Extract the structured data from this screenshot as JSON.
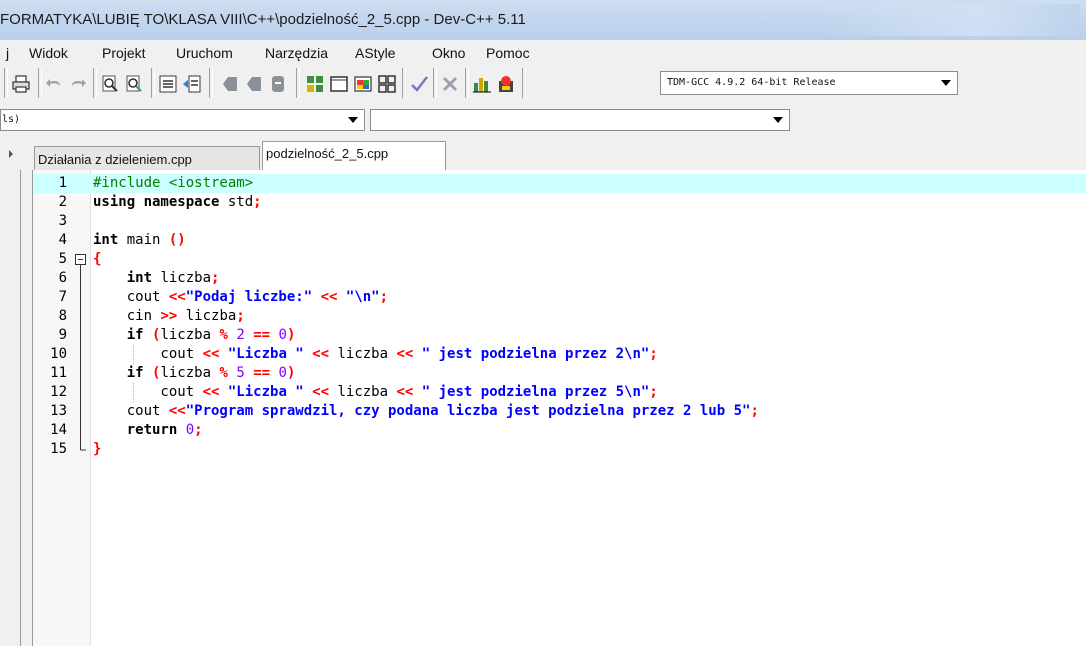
{
  "window": {
    "title": "FORMATYKA\\LUBIĘ TO\\KLASA VIII\\C++\\podzielność_2_5.cpp - Dev-C++ 5.11"
  },
  "menu": {
    "items": [
      "j",
      "Widok",
      "Projekt",
      "Uruchom",
      "Narzędzia",
      "AStyle",
      "Okno",
      "Pomoc"
    ]
  },
  "toolbar": {
    "compiler": "TDM-GCC 4.9.2 64-bit Release",
    "icons": [
      "save-all-icon",
      "print-icon",
      "undo-icon",
      "redo-icon",
      "find-icon",
      "replace-icon",
      "indent-icon",
      "unindent-icon",
      "bookmark-icon",
      "goto-icon",
      "compile-icon",
      "run-icon",
      "compile-run-icon",
      "rebuild-icon",
      "check-icon",
      "stop-icon",
      "chart-icon",
      "profile-icon"
    ]
  },
  "class_browser": {
    "class_combo": "ls)",
    "member_combo": ""
  },
  "tabs": [
    {
      "label": "Działania z dzieleniem.cpp",
      "active": false
    },
    {
      "label": "podzielność_2_5.cpp",
      "active": true
    }
  ],
  "editor": {
    "active_line": 1,
    "lines": [
      {
        "n": "1",
        "tokens": [
          {
            "t": "pp",
            "v": "#include <iostream>"
          }
        ]
      },
      {
        "n": "2",
        "tokens": [
          {
            "t": "kw",
            "v": "using namespace"
          },
          {
            "t": "plain",
            "v": " std"
          },
          {
            "t": "sym",
            "v": ";"
          }
        ]
      },
      {
        "n": "3",
        "tokens": []
      },
      {
        "n": "4",
        "tokens": [
          {
            "t": "kw",
            "v": "int"
          },
          {
            "t": "plain",
            "v": " main "
          },
          {
            "t": "sym",
            "v": "()"
          }
        ]
      },
      {
        "n": "5",
        "tokens": [
          {
            "t": "sym",
            "v": "{"
          }
        ],
        "fold": "start"
      },
      {
        "n": "6",
        "tokens": [
          {
            "t": "plain",
            "v": "    "
          },
          {
            "t": "kw",
            "v": "int"
          },
          {
            "t": "plain",
            "v": " liczba"
          },
          {
            "t": "sym",
            "v": ";"
          }
        ]
      },
      {
        "n": "7",
        "tokens": [
          {
            "t": "plain",
            "v": "    cout "
          },
          {
            "t": "sym",
            "v": "<<"
          },
          {
            "t": "str",
            "v": "\"Podaj liczbe:\""
          },
          {
            "t": "plain",
            "v": " "
          },
          {
            "t": "sym",
            "v": "<<"
          },
          {
            "t": "plain",
            "v": " "
          },
          {
            "t": "str",
            "v": "\"\\n\""
          },
          {
            "t": "sym",
            "v": ";"
          }
        ]
      },
      {
        "n": "8",
        "tokens": [
          {
            "t": "plain",
            "v": "    cin "
          },
          {
            "t": "sym",
            "v": ">>"
          },
          {
            "t": "plain",
            "v": " liczba"
          },
          {
            "t": "sym",
            "v": ";"
          }
        ]
      },
      {
        "n": "9",
        "tokens": [
          {
            "t": "plain",
            "v": "    "
          },
          {
            "t": "kw",
            "v": "if"
          },
          {
            "t": "plain",
            "v": " "
          },
          {
            "t": "sym",
            "v": "("
          },
          {
            "t": "plain",
            "v": "liczba "
          },
          {
            "t": "sym",
            "v": "%"
          },
          {
            "t": "plain",
            "v": " "
          },
          {
            "t": "num",
            "v": "2"
          },
          {
            "t": "plain",
            "v": " "
          },
          {
            "t": "sym",
            "v": "=="
          },
          {
            "t": "plain",
            "v": " "
          },
          {
            "t": "num",
            "v": "0"
          },
          {
            "t": "sym",
            "v": ")"
          }
        ]
      },
      {
        "n": "10",
        "tokens": [
          {
            "t": "plain",
            "v": "        cout "
          },
          {
            "t": "sym",
            "v": "<<"
          },
          {
            "t": "plain",
            "v": " "
          },
          {
            "t": "str",
            "v": "\"Liczba \""
          },
          {
            "t": "plain",
            "v": " "
          },
          {
            "t": "sym",
            "v": "<<"
          },
          {
            "t": "plain",
            "v": " liczba "
          },
          {
            "t": "sym",
            "v": "<<"
          },
          {
            "t": "plain",
            "v": " "
          },
          {
            "t": "str",
            "v": "\" jest podzielna przez 2\\n\""
          },
          {
            "t": "sym",
            "v": ";"
          }
        ],
        "guide": true
      },
      {
        "n": "11",
        "tokens": [
          {
            "t": "plain",
            "v": "    "
          },
          {
            "t": "kw",
            "v": "if"
          },
          {
            "t": "plain",
            "v": " "
          },
          {
            "t": "sym",
            "v": "("
          },
          {
            "t": "plain",
            "v": "liczba "
          },
          {
            "t": "sym",
            "v": "%"
          },
          {
            "t": "plain",
            "v": " "
          },
          {
            "t": "num",
            "v": "5"
          },
          {
            "t": "plain",
            "v": " "
          },
          {
            "t": "sym",
            "v": "=="
          },
          {
            "t": "plain",
            "v": " "
          },
          {
            "t": "num",
            "v": "0"
          },
          {
            "t": "sym",
            "v": ")"
          }
        ]
      },
      {
        "n": "12",
        "tokens": [
          {
            "t": "plain",
            "v": "        cout "
          },
          {
            "t": "sym",
            "v": "<<"
          },
          {
            "t": "plain",
            "v": " "
          },
          {
            "t": "str",
            "v": "\"Liczba \""
          },
          {
            "t": "plain",
            "v": " "
          },
          {
            "t": "sym",
            "v": "<<"
          },
          {
            "t": "plain",
            "v": " liczba "
          },
          {
            "t": "sym",
            "v": "<<"
          },
          {
            "t": "plain",
            "v": " "
          },
          {
            "t": "str",
            "v": "\" jest podzielna przez 5\\n\""
          },
          {
            "t": "sym",
            "v": ";"
          }
        ],
        "guide": true
      },
      {
        "n": "13",
        "tokens": [
          {
            "t": "plain",
            "v": "    cout "
          },
          {
            "t": "sym",
            "v": "<<"
          },
          {
            "t": "str",
            "v": "\"Program sprawdzil, czy podana liczba jest podzielna przez 2 lub 5\""
          },
          {
            "t": "sym",
            "v": ";"
          }
        ]
      },
      {
        "n": "14",
        "tokens": [
          {
            "t": "plain",
            "v": "    "
          },
          {
            "t": "kw",
            "v": "return"
          },
          {
            "t": "plain",
            "v": " "
          },
          {
            "t": "num",
            "v": "0"
          },
          {
            "t": "sym",
            "v": ";"
          }
        ]
      },
      {
        "n": "15",
        "tokens": [
          {
            "t": "sym",
            "v": "}"
          }
        ],
        "fold": "end"
      }
    ]
  },
  "colors": {
    "keyword": "#000000",
    "preprocessor": "#008000",
    "symbol": "#ff0000",
    "string": "#0000ff",
    "number": "#8000ff",
    "active_line": "#ccffff"
  }
}
